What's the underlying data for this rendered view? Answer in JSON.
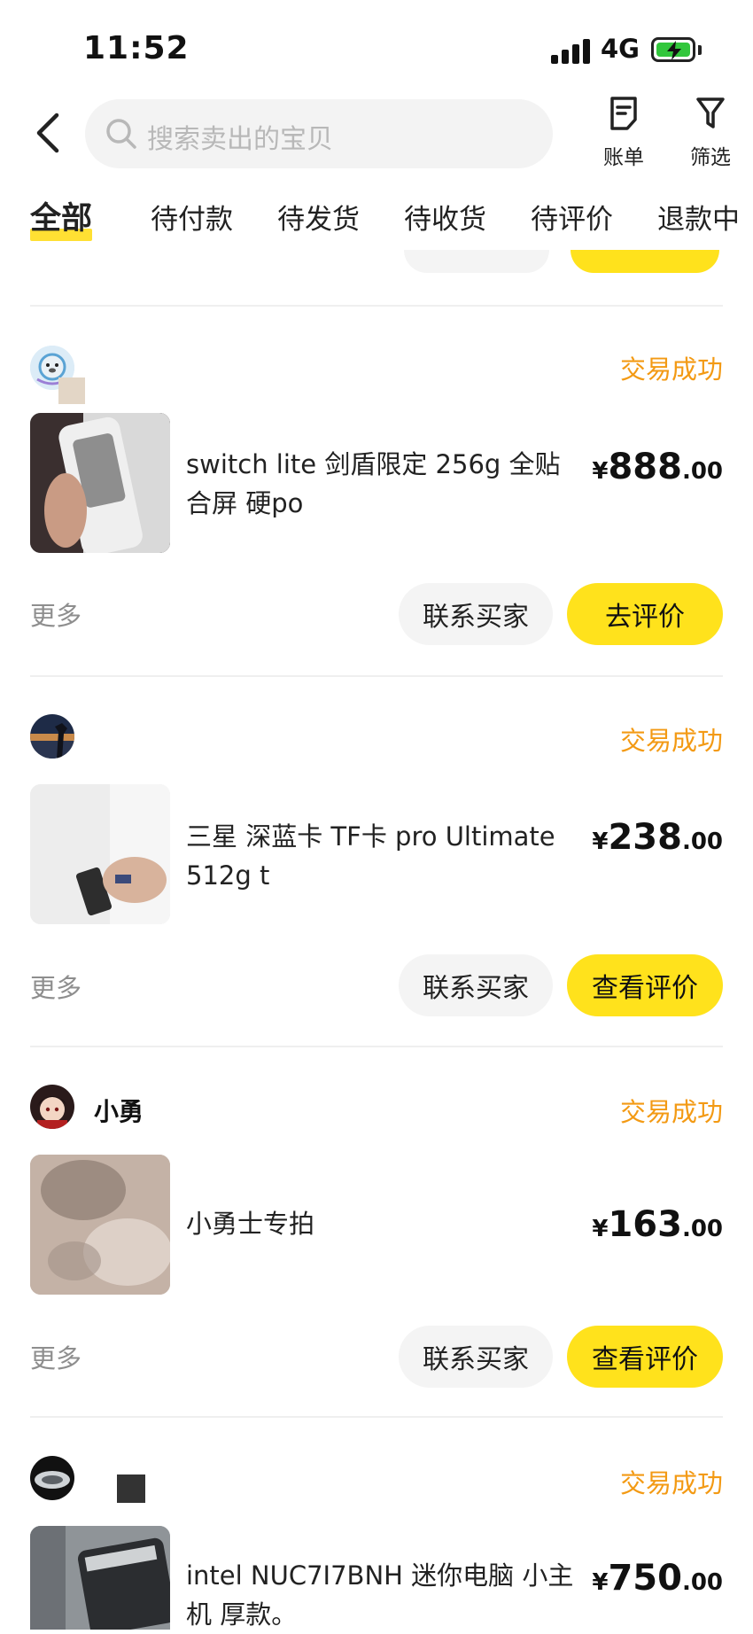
{
  "status_bar": {
    "time": "11:52",
    "network": "4G"
  },
  "header": {
    "search_placeholder": "搜索卖出的宝贝",
    "bill_label": "账单",
    "filter_label": "筛选"
  },
  "tabs": [
    {
      "label": "全部",
      "active": true
    },
    {
      "label": "待付款"
    },
    {
      "label": "待发货"
    },
    {
      "label": "待收货"
    },
    {
      "label": "待评价"
    },
    {
      "label": "退款中"
    }
  ],
  "orders": [
    {
      "seller": "",
      "status": "交易成功",
      "title": "switch lite 剑盾限定 256g 全贴合屏 硬po",
      "price_currency": "¥",
      "price_int": "888",
      "price_dec": ".00",
      "more": "更多",
      "contact_label": "联系买家",
      "action_label": "去评价"
    },
    {
      "seller": "",
      "status": "交易成功",
      "title": "三星 深蓝卡 TF卡 pro Ultimate 512g t",
      "price_currency": "¥",
      "price_int": "238",
      "price_dec": ".00",
      "more": "更多",
      "contact_label": "联系买家",
      "action_label": "查看评价"
    },
    {
      "seller": "小勇",
      "status": "交易成功",
      "title": "小勇士专拍",
      "price_currency": "¥",
      "price_int": "163",
      "price_dec": ".00",
      "more": "更多",
      "contact_label": "联系买家",
      "action_label": "查看评价"
    },
    {
      "seller": "",
      "status": "交易成功",
      "title": "intel NUC7I7BNH 迷你电脑 小主机 厚款。",
      "price_currency": "¥",
      "price_int": "750",
      "price_dec": ".00"
    }
  ],
  "colors": {
    "accent_yellow": "#ffe21c",
    "status_orange": "#f39a14",
    "battery_green": "#32c73c"
  }
}
